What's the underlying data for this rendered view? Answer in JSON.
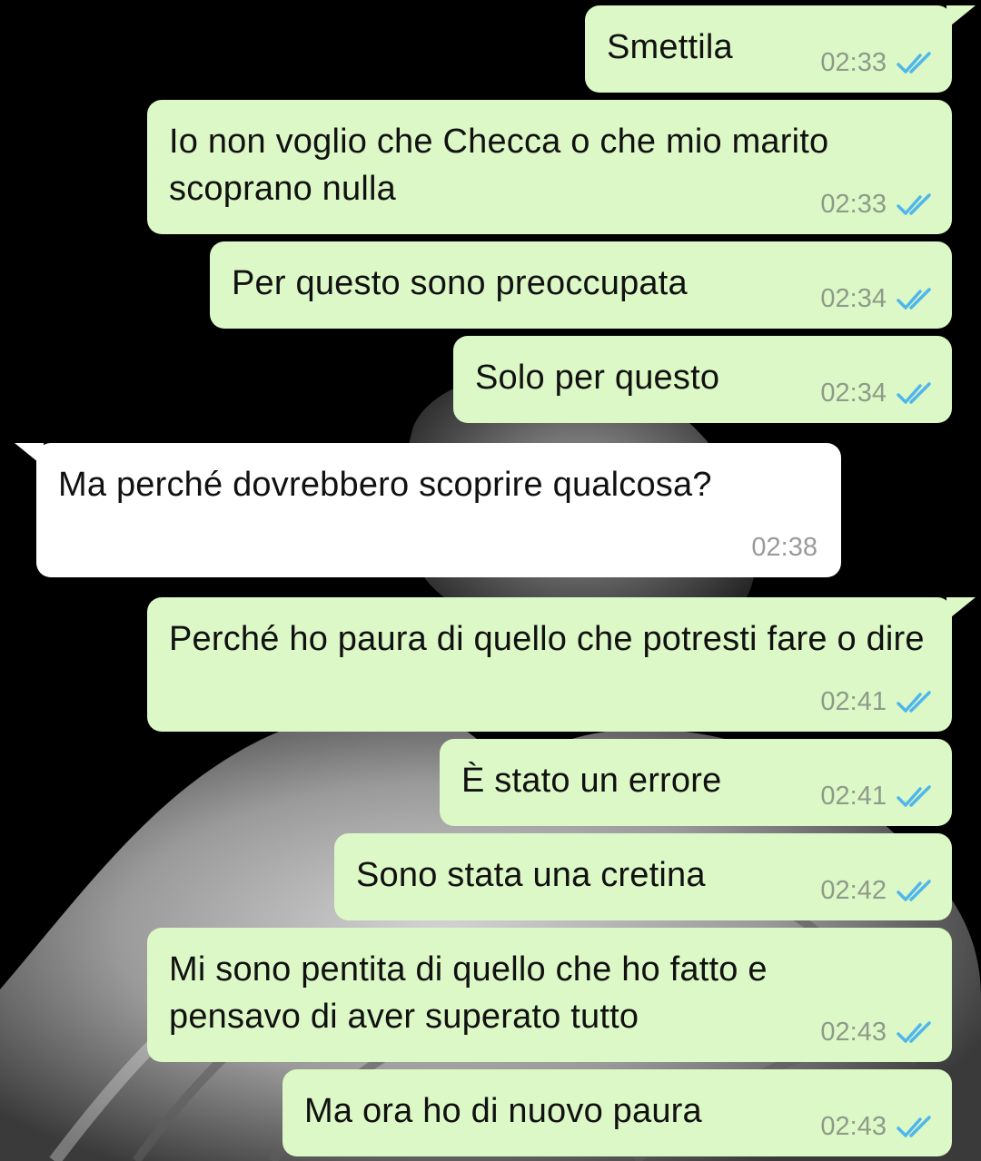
{
  "messages": [
    {
      "direction": "outgoing",
      "text": "Smettila",
      "time": "02:33",
      "status": "read"
    },
    {
      "direction": "outgoing",
      "text": "Io non voglio che Checca o che mio marito scoprano nulla",
      "time": "02:33",
      "status": "read"
    },
    {
      "direction": "outgoing",
      "text": "Per questo sono preoccupata",
      "time": "02:34",
      "status": "read"
    },
    {
      "direction": "outgoing",
      "text": "Solo per questo",
      "time": "02:34",
      "status": "read"
    },
    {
      "direction": "incoming",
      "text": "Ma perché dovrebbero scoprire qualcosa?",
      "time": "02:38"
    },
    {
      "direction": "outgoing",
      "text": "Perché ho paura di quello che potresti fare o dire",
      "time": "02:41",
      "status": "read"
    },
    {
      "direction": "outgoing",
      "text": "È stato un errore",
      "time": "02:41",
      "status": "read"
    },
    {
      "direction": "outgoing",
      "text": "Sono stata una cretina",
      "time": "02:42",
      "status": "read"
    },
    {
      "direction": "outgoing",
      "text": "Mi sono pentita di quello che ho fatto e pensavo di aver superato tutto",
      "time": "02:43",
      "status": "read"
    },
    {
      "direction": "outgoing",
      "text": "Ma ora ho di nuovo paura",
      "time": "02:43",
      "status": "read"
    }
  ],
  "colors": {
    "background": "#000000",
    "outgoing_bubble": "#dcf8c6",
    "incoming_bubble": "#ffffff",
    "read_tick": "#4fb6ec",
    "timestamp": "#8f9a8a"
  },
  "icons": {
    "read_receipt": "double-check-icon"
  }
}
